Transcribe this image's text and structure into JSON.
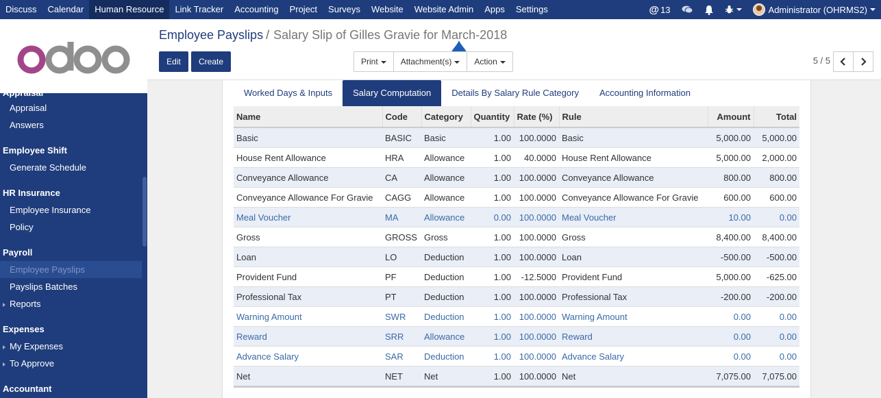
{
  "topbar": {
    "menu": [
      "Discuss",
      "Calendar",
      "Human Resource",
      "Link Tracker",
      "Accounting",
      "Project",
      "Surveys",
      "Website",
      "Website Admin",
      "Apps",
      "Settings"
    ],
    "active_index": 2,
    "mentions_count": "13",
    "user": "Administrator (OHRMS2)"
  },
  "sidebar": {
    "logo_text": "odoo",
    "clipped_section": "Appraisal",
    "groups": [
      {
        "items": [
          {
            "label": "Appraisal"
          },
          {
            "label": "Answers"
          }
        ]
      },
      {
        "title": "Employee Shift",
        "items": [
          {
            "label": "Generate Schedule"
          }
        ]
      },
      {
        "title": "HR Insurance",
        "items": [
          {
            "label": "Employee Insurance"
          },
          {
            "label": "Policy"
          }
        ]
      },
      {
        "title": "Payroll",
        "items": [
          {
            "label": "Employee Payslips",
            "active": true
          },
          {
            "label": "Payslips Batches"
          },
          {
            "label": "Reports",
            "arrow": true
          }
        ]
      },
      {
        "title": "Expenses",
        "items": [
          {
            "label": "My Expenses",
            "arrow": true
          },
          {
            "label": "To Approve",
            "arrow": true
          }
        ]
      },
      {
        "title": "Accountant",
        "items": []
      }
    ]
  },
  "breadcrumb": {
    "parent": "Employee Payslips",
    "separator": "/",
    "current": "Salary Slip of Gilles Gravie for March-2018"
  },
  "buttons": {
    "edit": "Edit",
    "create": "Create",
    "print": "Print",
    "attachments": "Attachment(s)",
    "action": "Action"
  },
  "pager": {
    "text": "5 / 5"
  },
  "tabs": [
    "Worked Days & Inputs",
    "Salary Computation",
    "Details By Salary Rule Category",
    "Accounting Information"
  ],
  "active_tab": 1,
  "table": {
    "columns": [
      "Name",
      "Code",
      "Category",
      "Quantity",
      "Rate (%)",
      "Rule",
      "Amount",
      "Total"
    ],
    "rows": [
      {
        "name": "Basic",
        "code": "BASIC",
        "category": "Basic",
        "quantity": "1.00",
        "rate": "100.0000",
        "rule": "Basic",
        "amount": "5,000.00",
        "total": "5,000.00",
        "blue": false
      },
      {
        "name": "House Rent Allowance",
        "code": "HRA",
        "category": "Allowance",
        "quantity": "1.00",
        "rate": "40.0000",
        "rule": "House Rent Allowance",
        "amount": "5,000.00",
        "total": "2,000.00",
        "blue": false
      },
      {
        "name": "Conveyance Allowance",
        "code": "CA",
        "category": "Allowance",
        "quantity": "1.00",
        "rate": "100.0000",
        "rule": "Conveyance Allowance",
        "amount": "800.00",
        "total": "800.00",
        "blue": false
      },
      {
        "name": "Conveyance Allowance For Gravie",
        "code": "CAGG",
        "category": "Allowance",
        "quantity": "1.00",
        "rate": "100.0000",
        "rule": "Conveyance Allowance For Gravie",
        "amount": "600.00",
        "total": "600.00",
        "blue": false
      },
      {
        "name": "Meal Voucher",
        "code": "MA",
        "category": "Allowance",
        "quantity": "0.00",
        "rate": "100.0000",
        "rule": "Meal Voucher",
        "amount": "10.00",
        "total": "0.00",
        "blue": true
      },
      {
        "name": "Gross",
        "code": "GROSS",
        "category": "Gross",
        "quantity": "1.00",
        "rate": "100.0000",
        "rule": "Gross",
        "amount": "8,400.00",
        "total": "8,400.00",
        "blue": false
      },
      {
        "name": "Loan",
        "code": "LO",
        "category": "Deduction",
        "quantity": "1.00",
        "rate": "100.0000",
        "rule": "Loan",
        "amount": "-500.00",
        "total": "-500.00",
        "blue": false
      },
      {
        "name": "Provident Fund",
        "code": "PF",
        "category": "Deduction",
        "quantity": "1.00",
        "rate": "-12.5000",
        "rule": "Provident Fund",
        "amount": "5,000.00",
        "total": "-625.00",
        "blue": false
      },
      {
        "name": "Professional Tax",
        "code": "PT",
        "category": "Deduction",
        "quantity": "1.00",
        "rate": "100.0000",
        "rule": "Professional Tax",
        "amount": "-200.00",
        "total": "-200.00",
        "blue": false
      },
      {
        "name": "Warning Amount",
        "code": "SWR",
        "category": "Deduction",
        "quantity": "1.00",
        "rate": "100.0000",
        "rule": "Warning Amount",
        "amount": "0.00",
        "total": "0.00",
        "blue": true
      },
      {
        "name": "Reward",
        "code": "SRR",
        "category": "Allowance",
        "quantity": "1.00",
        "rate": "100.0000",
        "rule": "Reward",
        "amount": "0.00",
        "total": "0.00",
        "blue": true
      },
      {
        "name": "Advance Salary",
        "code": "SAR",
        "category": "Deduction",
        "quantity": "1.00",
        "rate": "100.0000",
        "rule": "Advance Salary",
        "amount": "0.00",
        "total": "0.00",
        "blue": true
      },
      {
        "name": "Net",
        "code": "NET",
        "category": "Net",
        "quantity": "1.00",
        "rate": "100.0000",
        "rule": "Net",
        "amount": "7,075.00",
        "total": "7,075.00",
        "blue": false
      }
    ]
  },
  "colors": {
    "brand": "#1f3d7c",
    "link_blue": "#3a6aa6",
    "row_stripe": "#e9eef7",
    "logo_purple": "#a24689",
    "logo_gray": "#8f8f8f"
  },
  "icons": [
    "at-icon",
    "chat-icon",
    "bell-icon",
    "bug-icon",
    "chevron-left-icon",
    "chevron-right-icon",
    "caret-down-icon"
  ]
}
